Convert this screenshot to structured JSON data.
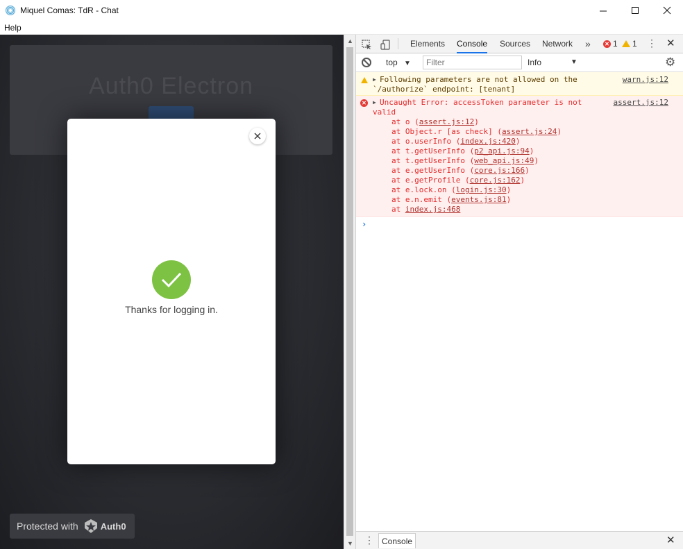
{
  "window": {
    "title": "Miquel Comas: TdR - Chat",
    "minimize_glyph": "—",
    "maximize_glyph": "☐",
    "close_glyph": "✕"
  },
  "menu": {
    "items": [
      "Help"
    ]
  },
  "app": {
    "hero_title": "Auth0 Electron",
    "modal": {
      "close_glyph": "✕",
      "success_message": "Thanks for logging in.",
      "check_color": "#7dc243"
    },
    "protected": {
      "text": "Protected with",
      "brand": "Auth0"
    }
  },
  "devtools": {
    "tabs": [
      "Elements",
      "Console",
      "Sources",
      "Network"
    ],
    "active_tab": "Console",
    "more_glyph": "»",
    "error_count": "1",
    "warning_count": "1",
    "context": "top",
    "filter_placeholder": "Filter",
    "level": "Info",
    "drawer_tab": "Console",
    "messages": {
      "warning": {
        "line1": "Following parameters are not allowed on the",
        "line2": "`/authorize` endpoint: [tenant]",
        "source": "warn.js:12"
      },
      "error": {
        "line1": "Uncaught Error: accessToken parameter is not",
        "line2": "valid",
        "source": "assert.js:12",
        "stack": [
          {
            "prefix": "at o (",
            "link": "assert.js:12",
            "suffix": ")"
          },
          {
            "prefix": "at Object.r [as check] (",
            "link": "assert.js:24",
            "suffix": ")"
          },
          {
            "prefix": "at o.userInfo (",
            "link": "index.js:420",
            "suffix": ")"
          },
          {
            "prefix": "at t.getUserInfo (",
            "link": "p2_api.js:94",
            "suffix": ")"
          },
          {
            "prefix": "at t.getUserInfo (",
            "link": "web_api.js:49",
            "suffix": ")"
          },
          {
            "prefix": "at e.getUserInfo (",
            "link": "core.js:166",
            "suffix": ")"
          },
          {
            "prefix": "at e.getProfile (",
            "link": "core.js:162",
            "suffix": ")"
          },
          {
            "prefix": "at e.lock.on (",
            "link": "login.js:30",
            "suffix": ")"
          },
          {
            "prefix": "at e.n.emit (",
            "link": "events.js:81",
            "suffix": ")"
          },
          {
            "prefix": "at ",
            "link": "index.js:468",
            "suffix": ""
          }
        ]
      },
      "prompt": "›"
    }
  }
}
